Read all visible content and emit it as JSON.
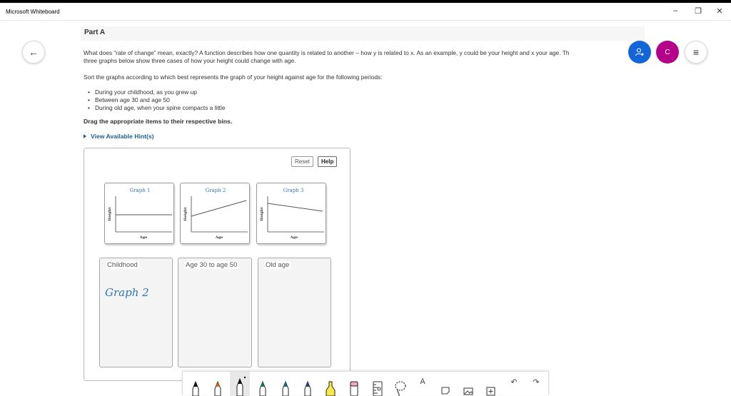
{
  "window": {
    "title": "Microsoft Whiteboard",
    "minimize": "–",
    "restore": "❐",
    "close": "✕"
  },
  "nav": {
    "back_icon": "←"
  },
  "top_right": {
    "invite_icon": "person-add",
    "avatar_initial": "C",
    "menu_icon": "≡",
    "colors": {
      "invite": "#1466d8",
      "avatar": "#b5008a"
    }
  },
  "content": {
    "part_label": "Part A",
    "question_line1": "What does “rate of change” mean, exactly? A function describes how one quantity is related to another – how y is related to x. As an example, y could be your height and x your age. Th",
    "question_line2": "three graphs below show three cases of how your height could change with age.",
    "sort_instruction": "Sort the graphs according to which best represents the graph of your height against age for the following periods:",
    "bullets": [
      "During your childhood, as you grew up",
      "Between age 30 and age 50",
      "During old age, when your spine compacts a little"
    ],
    "drag_instruction": "Drag the appropriate items to their respective bins.",
    "hint_link": "View Available Hint(s)"
  },
  "panel": {
    "reset_label": "Reset",
    "help_label": "Help",
    "graphs": [
      {
        "title": "Graph 1",
        "ylabel": "Height",
        "xlabel": "Age",
        "trend": "flat"
      },
      {
        "title": "Graph 2",
        "ylabel": "Height",
        "xlabel": "Age",
        "trend": "increasing"
      },
      {
        "title": "Graph 3",
        "ylabel": "Height",
        "xlabel": "Age",
        "trend": "decreasing"
      }
    ],
    "bins": [
      {
        "label": "Childhood"
      },
      {
        "label": "Age 30 to age 50"
      },
      {
        "label": "Old age"
      }
    ],
    "handwritten_note": "Graph 2",
    "graph_title_color": "#3a74b8"
  },
  "toolbar": {
    "tools": [
      "pen-black",
      "pen-orange",
      "pen-black-selected",
      "pen-green",
      "pen-teal",
      "pen-navy",
      "highlighter-yellow",
      "eraser-pink",
      "ruler",
      "lasso",
      "text",
      "note",
      "image",
      "insert",
      "undo",
      "redo"
    ],
    "text_tool_glyph": "A",
    "undo_glyph": "↶",
    "redo_glyph": "↷"
  }
}
